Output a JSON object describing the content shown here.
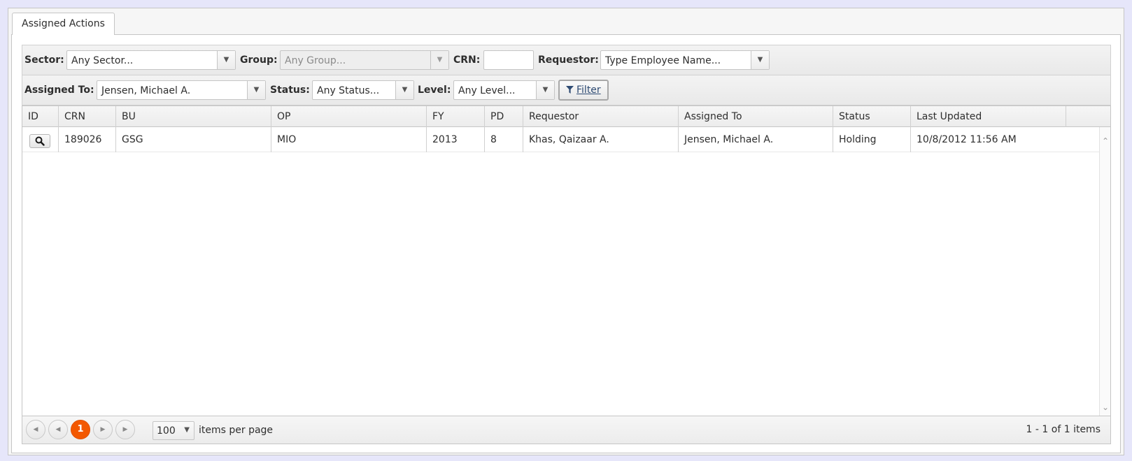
{
  "tab": {
    "label": "Assigned Actions"
  },
  "filters": {
    "sector": {
      "label": "Sector:",
      "value": "Any Sector..."
    },
    "group": {
      "label": "Group:",
      "value": "Any Group..."
    },
    "crn": {
      "label": "CRN:",
      "value": ""
    },
    "requestor": {
      "label": "Requestor:",
      "value": "Type Employee Name..."
    },
    "assigned_to": {
      "label": "Assigned To:",
      "value": "Jensen, Michael A."
    },
    "status": {
      "label": "Status:",
      "value": "Any Status..."
    },
    "level": {
      "label": "Level:",
      "value": "Any Level..."
    },
    "filter_button": "Filter"
  },
  "grid": {
    "columns": [
      "ID",
      "CRN",
      "BU",
      "OP",
      "FY",
      "PD",
      "Requestor",
      "Assigned To",
      "Status",
      "Last Updated"
    ],
    "rows": [
      {
        "crn": "189026",
        "bu": "GSG",
        "op": "MIO",
        "fy": "2013",
        "pd": "8",
        "requestor": "Khas, Qaizaar A.",
        "assigned_to": "Jensen, Michael A.",
        "status": "Holding",
        "last_updated": "10/8/2012 11:56 AM"
      }
    ]
  },
  "pager": {
    "current_page": "1",
    "page_size": "100",
    "items_per_page_label": "items per page",
    "info": "1 - 1 of 1 items"
  },
  "icons": {
    "search": "magnifier-icon",
    "filter": "funnel-icon",
    "arrow": "down-triangle-icon"
  },
  "colors": {
    "accent": "#f35800",
    "background": "#e6e6fa",
    "link": "#2e4b73"
  }
}
